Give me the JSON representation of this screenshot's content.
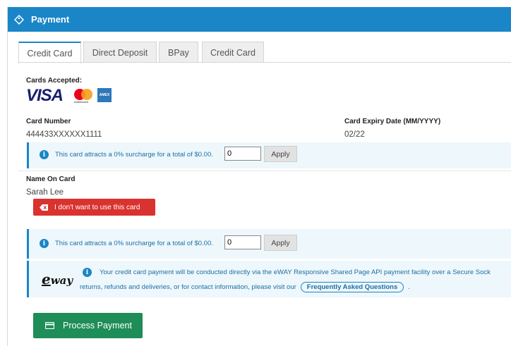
{
  "header": {
    "title": "Payment",
    "icon": "tag-icon",
    "color": "#1a86c7"
  },
  "tabs": [
    {
      "label": "Credit Card",
      "active": true
    },
    {
      "label": "Direct Deposit",
      "active": false
    },
    {
      "label": "BPay",
      "active": false
    },
    {
      "label": "Credit Card",
      "active": false
    }
  ],
  "cards_accepted": {
    "label": "Cards Accepted:",
    "brands": [
      "VISA",
      "mastercard",
      "AMEX"
    ]
  },
  "card_number": {
    "label": "Card Number",
    "value": "444433XXXXXX1111"
  },
  "card_expiry": {
    "label": "Card Expiry Date (MM/YYYY)",
    "value": "02/22"
  },
  "surcharge1": {
    "message": "This card attracts a 0% surcharge for a total of $0.00.",
    "input_value": "0",
    "apply_label": "Apply"
  },
  "name_on_card": {
    "label": "Name On Card",
    "value": "Sarah Lee"
  },
  "remove_card": {
    "label": "I don't want to use this card",
    "color": "#d9322f"
  },
  "surcharge2": {
    "message": "This card attracts a 0% surcharge for a total of $0.00.",
    "input_value": "0",
    "apply_label": "Apply"
  },
  "eway": {
    "logo_e": "e",
    "logo_rest": "way",
    "line1": "Your credit card payment will be conducted directly via the eWAY Responsive Shared Page API payment facility over a Secure Sock",
    "line2": "returns, refunds and deliveries, or for contact information, please visit our",
    "faq_label": "Frequently Asked Questions",
    "line2_end": "."
  },
  "process_button": {
    "label": "Process Payment",
    "color": "#1e8d57"
  }
}
